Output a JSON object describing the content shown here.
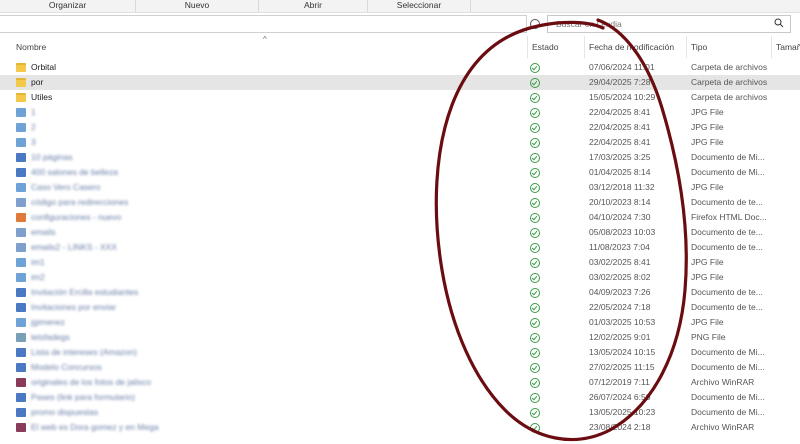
{
  "ribbon": {
    "organize": "Organizar",
    "new": "Nuevo",
    "open": "Abrir",
    "select": "Seleccionar"
  },
  "search": {
    "placeholder": "Buscar en Lexdia"
  },
  "columns": {
    "name": "Nombre",
    "status": "Estado",
    "modified": "Fecha de modificación",
    "type": "Tipo",
    "size": "Tamaño"
  },
  "files": [
    {
      "name": "Orbital",
      "date": "07/06/2024 11:01",
      "type": "Carpeta de archivos",
      "icon": "folder-icon",
      "blurred": false,
      "selected": false,
      "size": ""
    },
    {
      "name": "por",
      "date": "29/04/2025 7:28",
      "type": "Carpeta de archivos",
      "icon": "folder-icon",
      "blurred": false,
      "selected": true,
      "size": ""
    },
    {
      "name": "Utiles",
      "date": "15/05/2024 10:29",
      "type": "Carpeta de archivos",
      "icon": "folder-icon",
      "blurred": false,
      "selected": false,
      "size": ""
    },
    {
      "name": "1",
      "date": "22/04/2025 8:41",
      "type": "JPG File",
      "icon": "img-icon",
      "blurred": true,
      "selected": false,
      "size": ""
    },
    {
      "name": "2",
      "date": "22/04/2025 8:41",
      "type": "JPG File",
      "icon": "img-icon",
      "blurred": true,
      "selected": false,
      "size": ""
    },
    {
      "name": "3",
      "date": "22/04/2025 8:41",
      "type": "JPG File",
      "icon": "img-icon",
      "blurred": true,
      "selected": false,
      "size": ""
    },
    {
      "name": "10 páginas",
      "date": "17/03/2025 3:25",
      "type": "Documento de Mi...",
      "icon": "doc-icon",
      "blurred": true,
      "selected": false,
      "size": ""
    },
    {
      "name": "400 salones de belleza",
      "date": "01/04/2025 8:14",
      "type": "Documento de Mi...",
      "icon": "doc-icon",
      "blurred": true,
      "selected": false,
      "size": ""
    },
    {
      "name": "Caso Vero Casero",
      "date": "03/12/2018 11:32",
      "type": "JPG File",
      "icon": "img-icon",
      "blurred": true,
      "selected": false,
      "size": ""
    },
    {
      "name": "código para redirecciones",
      "date": "20/10/2023 8:14",
      "type": "Documento de te...",
      "icon": "file-icon",
      "blurred": true,
      "selected": false,
      "size": ""
    },
    {
      "name": "configuraciones - nuevo",
      "date": "04/10/2024 7:30",
      "type": "Firefox HTML Doc...",
      "icon": "fx-icon",
      "blurred": true,
      "selected": false,
      "size": ""
    },
    {
      "name": "emails",
      "date": "05/08/2023 10:03",
      "type": "Documento de te...",
      "icon": "file-icon",
      "blurred": true,
      "selected": false,
      "size": ""
    },
    {
      "name": "emails2 - LINKS - XXX",
      "date": "11/08/2023 7:04",
      "type": "Documento de te...",
      "icon": "file-icon",
      "blurred": true,
      "selected": false,
      "size": ""
    },
    {
      "name": "im1",
      "date": "03/02/2025 8:41",
      "type": "JPG File",
      "icon": "img-icon",
      "blurred": true,
      "selected": false,
      "size": ""
    },
    {
      "name": "im2",
      "date": "03/02/2025 8:02",
      "type": "JPG File",
      "icon": "img-icon",
      "blurred": true,
      "selected": false,
      "size": ""
    },
    {
      "name": "Invitación Ercilla estudiantes",
      "date": "04/09/2023 7:26",
      "type": "Documento de te...",
      "icon": "doc-icon",
      "blurred": true,
      "selected": false,
      "size": ""
    },
    {
      "name": "Invitaciones por enviar",
      "date": "22/05/2024 7:18",
      "type": "Documento de te...",
      "icon": "doc-icon",
      "blurred": true,
      "selected": false,
      "size": ""
    },
    {
      "name": "jgimenez",
      "date": "01/03/2025 10:53",
      "type": "JPG File",
      "icon": "img-icon",
      "blurred": true,
      "selected": false,
      "size": ""
    },
    {
      "name": "letsfadegs",
      "date": "12/02/2025 9:01",
      "type": "PNG File",
      "icon": "png-icon",
      "blurred": true,
      "selected": false,
      "size": ""
    },
    {
      "name": "Lista de intereses (Amazon)",
      "date": "13/05/2024 10:15",
      "type": "Documento de Mi...",
      "icon": "doc-icon",
      "blurred": true,
      "selected": false,
      "size": ""
    },
    {
      "name": "Modelo Concursos",
      "date": "27/02/2025 11:15",
      "type": "Documento de Mi...",
      "icon": "doc-icon",
      "blurred": true,
      "selected": false,
      "size": ""
    },
    {
      "name": "originales de los fotos de jalisco",
      "date": "07/12/2019 7:11",
      "type": "Archivo WinRAR",
      "icon": "rar-icon",
      "blurred": true,
      "selected": false,
      "size": ""
    },
    {
      "name": "Pases (link para formulario)",
      "date": "26/07/2024 6:50",
      "type": "Documento de Mi...",
      "icon": "doc-icon",
      "blurred": true,
      "selected": false,
      "size": ""
    },
    {
      "name": "promo dispuestas",
      "date": "13/05/2025 10:23",
      "type": "Documento de Mi...",
      "icon": "doc-icon",
      "blurred": true,
      "selected": false,
      "size": ""
    },
    {
      "name": "El web es Dora gomez y en Mega",
      "date": "23/08/2024 2:18",
      "type": "Archivo WinRAR",
      "icon": "rar-icon",
      "blurred": true,
      "selected": false,
      "size": ""
    }
  ]
}
